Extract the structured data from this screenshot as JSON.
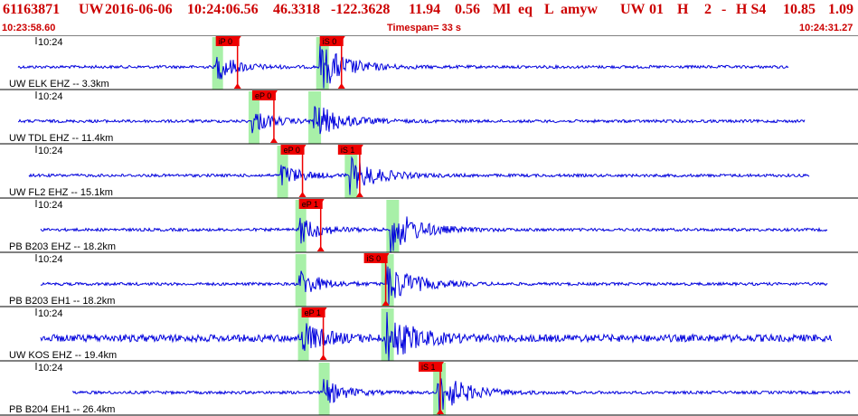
{
  "header": {
    "event_id": "61163871",
    "network": "UW",
    "date": "2016-06-06",
    "time": "10:24:06.56",
    "lat": "46.3318",
    "lon": "-122.3628",
    "depth": "11.94",
    "magnitude": "0.56",
    "mag_type": "Ml",
    "event_type": "eq",
    "flag": "L",
    "author": "amyw",
    "net_code": "UW",
    "quality": "01",
    "q1": "H",
    "q2": "2",
    "q3": "-",
    "q4": "H S4",
    "stat1": "10.85",
    "stat2": "1.09"
  },
  "subheader": {
    "start_time": "10:23:58.60",
    "timespan": "Timespan=  33 s",
    "end_time": "10:24:31.27"
  },
  "colors": {
    "trace": "#0000dd",
    "pick": "#ee0000",
    "window": "#a8f0a8",
    "divider": "#000000",
    "header_text": "#cc0000"
  },
  "time_tick_label": "10:24",
  "panels": [
    {
      "label": "UW ELK EHZ -- 3.3km",
      "picks": [
        {
          "text": "iP 0",
          "t": 8.3
        },
        {
          "text": "iS 0",
          "t": 12.3
        }
      ],
      "arrival_p": 8.3,
      "arrival_s": 12.3,
      "amp": 1.0
    },
    {
      "label": "UW TDL EHZ -- 11.4km",
      "picks": [
        {
          "text": "eP 0",
          "t": 9.7
        }
      ],
      "arrival_p": 9.7,
      "arrival_s": 12.0,
      "amp": 0.8
    },
    {
      "label": "UW FL2 EHZ -- 15.1km",
      "picks": [
        {
          "text": "eP 0",
          "t": 10.8
        },
        {
          "text": "iS 1",
          "t": 13.0
        }
      ],
      "arrival_p": 10.8,
      "arrival_s": 13.4,
      "amp": 0.8
    },
    {
      "label": "PB B203 EHZ -- 18.2km",
      "picks": [
        {
          "text": "eP 1",
          "t": 11.5
        }
      ],
      "arrival_p": 11.5,
      "arrival_s": 15.0,
      "amp": 1.0
    },
    {
      "label": "PB B203 EH1 -- 18.2km",
      "picks": [
        {
          "text": "iS 0",
          "t": 14.0
        }
      ],
      "arrival_p": 11.5,
      "arrival_s": 14.8,
      "amp": 1.0
    },
    {
      "label": "UW KOS EHZ -- 19.4km",
      "picks": [
        {
          "text": "eP 1",
          "t": 11.6
        }
      ],
      "arrival_p": 11.6,
      "arrival_s": 14.8,
      "amp": 1.1
    },
    {
      "label": "PB B204 EH1 -- 26.4km",
      "picks": [
        {
          "text": "iS 1",
          "t": 16.1
        }
      ],
      "arrival_p": 12.4,
      "arrival_s": 16.8,
      "amp": 1.0
    }
  ]
}
